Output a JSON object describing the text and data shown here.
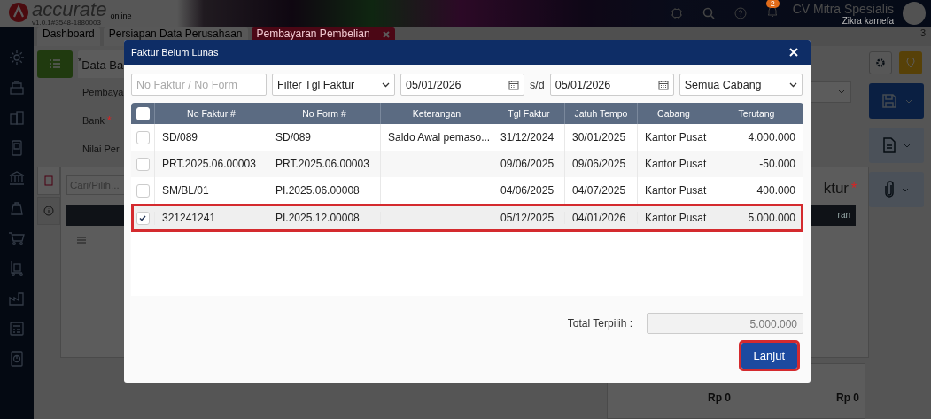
{
  "header": {
    "logo": "accurate",
    "logo_sub": "online",
    "version": "v1.0.1#3548-1880003",
    "notification_count": "2",
    "company": "CV Mitra Spesialis",
    "user": "Zikra karnefa"
  },
  "tabs": [
    {
      "label": "Dashboard",
      "selected": false
    },
    {
      "label": "Persiapan Data Perusahaan",
      "selected": false
    },
    {
      "label": "Pembayaran Pembelian",
      "selected": true
    }
  ],
  "tab_count": "3",
  "form": {
    "section_tab": {
      "mark": "*",
      "label": "Data Ba"
    },
    "fields": [
      {
        "label": "Pembaya"
      },
      {
        "label": "Bank",
        "mark": "*"
      },
      {
        "label": "Nilai Per"
      }
    ],
    "search_placeholder": "Cari/Pilih...",
    "detail_title": "ktur",
    "detail_mark": "*",
    "detail_column": "ran",
    "totals": [
      "Rp 0",
      "Rp 0"
    ]
  },
  "dialog": {
    "title": "Faktur Belum Lunas",
    "search_placeholder": "No Faktur / No Form",
    "date_filter": "Filter Tgl Faktur",
    "date_from": "05/01/2026",
    "range_separator": "s/d",
    "date_to": "05/01/2026",
    "branch": "Semua Cabang",
    "header_checked": false,
    "columns": [
      "No Faktur #",
      "No Form #",
      "Keterangan",
      "Tgl Faktur",
      "Jatuh Tempo",
      "Cabang",
      "Terutang"
    ],
    "rows": [
      {
        "checked": false,
        "highlighted": false,
        "cells": [
          "SD/089",
          "SD/089",
          "Saldo Awal pemaso...",
          "31/12/2024",
          "30/01/2025",
          "Kantor Pusat",
          "4.000.000"
        ]
      },
      {
        "checked": false,
        "highlighted": false,
        "cells": [
          "PRT.2025.06.00003",
          "PRT.2025.06.00003",
          "",
          "09/06/2025",
          "09/06/2025",
          "Kantor Pusat",
          "-50.000"
        ]
      },
      {
        "checked": false,
        "highlighted": false,
        "cells": [
          "SM/BL/01",
          "PI.2025.06.00008",
          "",
          "04/06/2025",
          "04/07/2025",
          "Kantor Pusat",
          "400.000"
        ]
      },
      {
        "checked": true,
        "highlighted": true,
        "cells": [
          "321241241",
          "PI.2025.12.00008",
          "",
          "05/12/2025",
          "04/01/2026",
          "Kantor Pusat",
          "5.000.000"
        ]
      }
    ],
    "total_label": "Total Terpilih :",
    "total_value": "5.000.000",
    "continue_button": {
      "label": "Lanjut",
      "highlighted": true
    }
  }
}
